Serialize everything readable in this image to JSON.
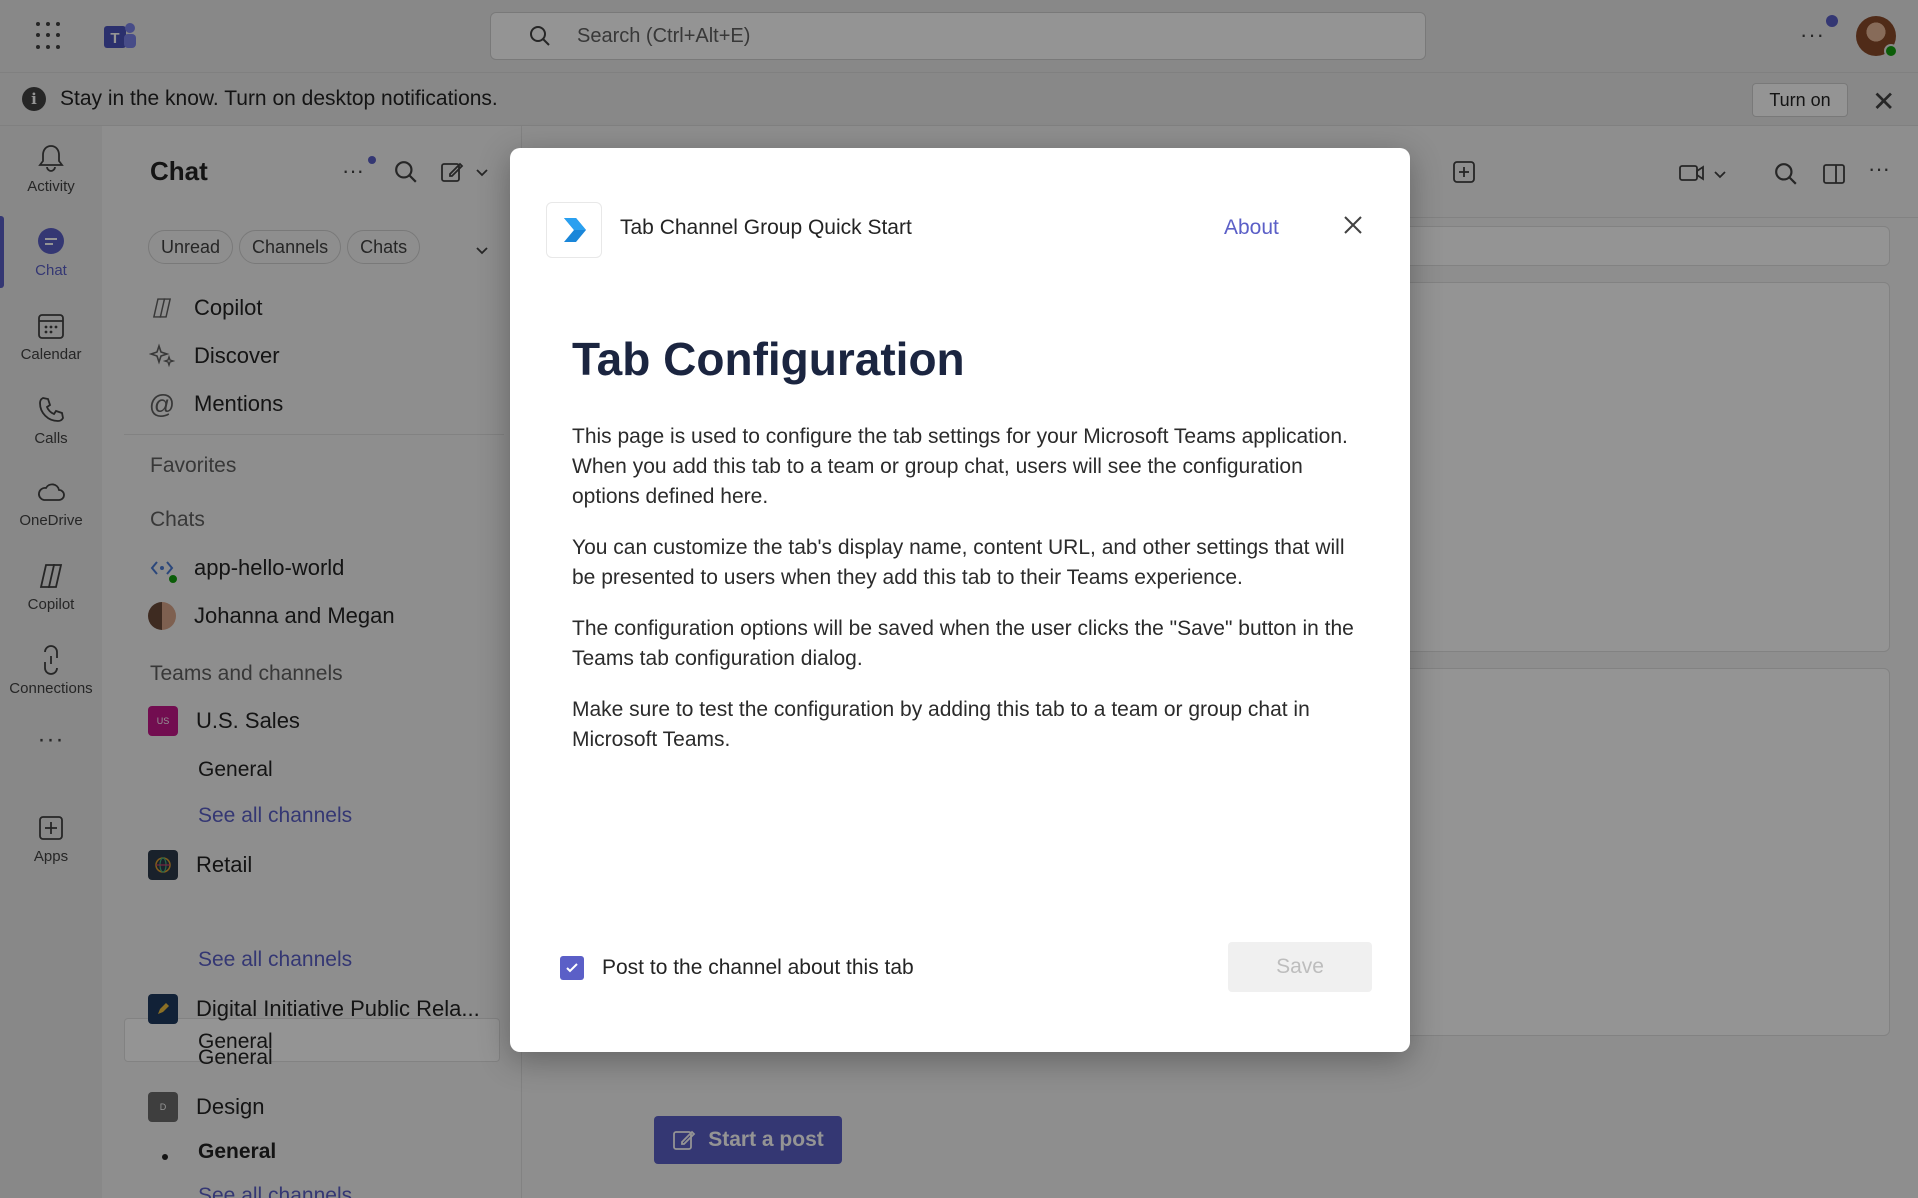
{
  "titlebar": {
    "search_placeholder": "Search (Ctrl+Alt+E)"
  },
  "banner": {
    "text": "Stay in the know. Turn on desktop notifications.",
    "turn_on_label": "Turn on"
  },
  "rail": {
    "items": [
      {
        "label": "Activity",
        "icon": "bell-icon"
      },
      {
        "label": "Chat",
        "icon": "chat-icon"
      },
      {
        "label": "Calendar",
        "icon": "calendar-icon"
      },
      {
        "label": "Calls",
        "icon": "phone-icon"
      },
      {
        "label": "OneDrive",
        "icon": "cloud-icon"
      },
      {
        "label": "Copilot",
        "icon": "copilot-icon"
      },
      {
        "label": "Connections",
        "icon": "connections-icon"
      },
      {
        "label": "Apps",
        "icon": "apps-add-icon"
      }
    ],
    "active": "Chat"
  },
  "chat_pane": {
    "title": "Chat",
    "filters": [
      "Unread",
      "Channels",
      "Chats"
    ],
    "quick_items": [
      {
        "label": "Copilot",
        "icon": "copilot-icon"
      },
      {
        "label": "Discover",
        "icon": "sparkle-icon"
      },
      {
        "label": "Mentions",
        "icon": "at-icon"
      }
    ],
    "favorites_label": "Favorites",
    "chats_label": "Chats",
    "chats": [
      {
        "label": "app-hello-world"
      },
      {
        "label": "Johanna and Megan"
      }
    ],
    "teams_label": "Teams and channels",
    "teams": [
      {
        "name": "U.S. Sales",
        "abbr": "US",
        "color": "#c4178b",
        "channel": "General",
        "see_all": "See all channels"
      },
      {
        "name": "Retail",
        "abbr": "",
        "color": "#2b3a4a",
        "channel": "General",
        "see_all": "See all channels"
      },
      {
        "name": "Digital Initiative Public Rela...",
        "abbr": "",
        "color": "#1e3a5f",
        "channel": "General"
      },
      {
        "name": "Design",
        "abbr": "D",
        "color": "#6b6b6b",
        "channel": "General",
        "see_all": "See all channels"
      }
    ]
  },
  "main": {
    "start_post_label": "Start a post"
  },
  "dialog": {
    "app_name": "Tab Channel Group Quick Start",
    "about_label": "About",
    "heading": "Tab Configuration",
    "paragraphs": [
      "This page is used to configure the tab settings for your Microsoft Teams application. When you add this tab to a team or group chat, users will see the configuration options defined here.",
      "You can customize the tab's display name, content URL, and other settings that will be presented to users when they add this tab to their Teams experience.",
      "The configuration options will be saved when the user clicks the \"Save\" button in the Teams tab configuration dialog.",
      "Make sure to test the configuration by adding this tab to a team or group chat in Microsoft Teams."
    ],
    "checkbox_label": "Post to the channel about this tab",
    "checkbox_checked": true,
    "save_label": "Save"
  },
  "colors": {
    "accent": "#5b5fc7",
    "presence_available": "#13a10e"
  }
}
